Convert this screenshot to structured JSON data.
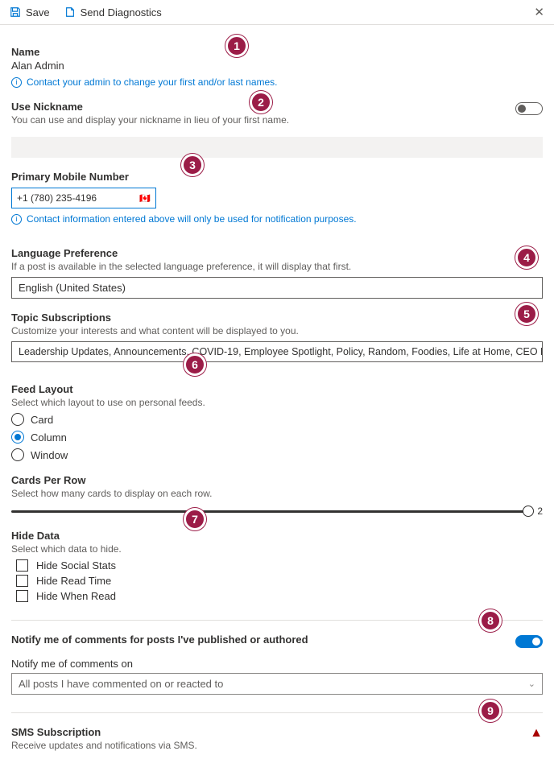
{
  "toolbar": {
    "save": "Save",
    "send_diag": "Send Diagnostics"
  },
  "name": {
    "label": "Name",
    "value": "Alan Admin",
    "hint": "Contact your admin to change your first and/or last names."
  },
  "nickname": {
    "label": "Use Nickname",
    "desc": "You can use and display your nickname in lieu of your first name."
  },
  "phone": {
    "label": "Primary Mobile Number",
    "value": "+1 (780) 235-4196",
    "flag": "🇨🇦",
    "hint": "Contact information entered above will only be used for notification purposes."
  },
  "lang": {
    "label": "Language Preference",
    "desc": "If a post is available in the selected language preference, it will display that first.",
    "value": "English (United States)"
  },
  "topics": {
    "label": "Topic Subscriptions",
    "desc": "Customize your interests and what content will be displayed to you.",
    "value": "Leadership Updates, Announcements, COVID-19, Employee Spotlight, Policy, Random, Foodies, Life at Home, CEO Message, Innovation,"
  },
  "feed": {
    "label": "Feed Layout",
    "desc": "Select which layout to use on personal feeds.",
    "options": [
      "Card",
      "Column",
      "Window"
    ],
    "selected": "Column"
  },
  "cards": {
    "label": "Cards Per Row",
    "desc": "Select how many cards to display on each row.",
    "value": "2"
  },
  "hide": {
    "label": "Hide Data",
    "desc": "Select which data to hide.",
    "options": [
      "Hide Social Stats",
      "Hide Read Time",
      "Hide When Read"
    ]
  },
  "notify1": {
    "label": "Notify me of comments for posts I've published or authored"
  },
  "notify2": {
    "label": "Notify me of comments on",
    "value": "All posts I have commented on or reacted to"
  },
  "sms": {
    "label": "SMS Subscription",
    "desc": "Receive updates and notifications via SMS."
  },
  "markers": {
    "m1": "1",
    "m2": "2",
    "m3": "3",
    "m4": "4",
    "m5": "5",
    "m6": "6",
    "m7": "7",
    "m8": "8",
    "m9": "9"
  }
}
